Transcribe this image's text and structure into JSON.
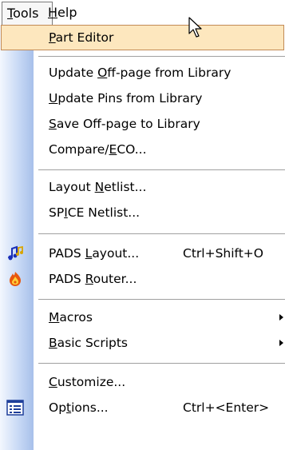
{
  "menubar": {
    "tools": {
      "pre": "",
      "acc": "T",
      "post": "ools"
    },
    "help": {
      "pre": "",
      "acc": "H",
      "post": "elp"
    }
  },
  "menu": {
    "items": [
      {
        "pre": "",
        "acc": "P",
        "post": "art Editor"
      },
      {
        "pre": "Update ",
        "acc": "O",
        "post": "ff-page from Library"
      },
      {
        "pre": "",
        "acc": "U",
        "post": "pdate Pins from Library"
      },
      {
        "pre": "",
        "acc": "S",
        "post": "ave Off-page to Library"
      },
      {
        "pre": "Compare/",
        "acc": "E",
        "post": "CO..."
      },
      {
        "pre": "Layout ",
        "acc": "N",
        "post": "etlist..."
      },
      {
        "pre": "SP",
        "acc": "I",
        "post": "CE Netlist..."
      },
      {
        "pre": "PADS ",
        "acc": "L",
        "post": "ayout...",
        "shortcut": "Ctrl+Shift+O",
        "icon": "pads-layout-icon"
      },
      {
        "pre": "PADS ",
        "acc": "R",
        "post": "outer...",
        "icon": "pads-router-icon"
      },
      {
        "pre": "",
        "acc": "M",
        "post": "acros",
        "submenu": true
      },
      {
        "pre": "",
        "acc": "B",
        "post": "asic Scripts",
        "submenu": true
      },
      {
        "pre": "",
        "acc": "C",
        "post": "ustomize..."
      },
      {
        "pre": "Op",
        "acc": "t",
        "post": "ions...",
        "shortcut": "Ctrl+<Enter>",
        "icon": "options-icon"
      }
    ]
  },
  "colors": {
    "highlight_bg": "#fde7be",
    "highlight_border": "#c28a55",
    "gutter": "#c8d9f5"
  }
}
